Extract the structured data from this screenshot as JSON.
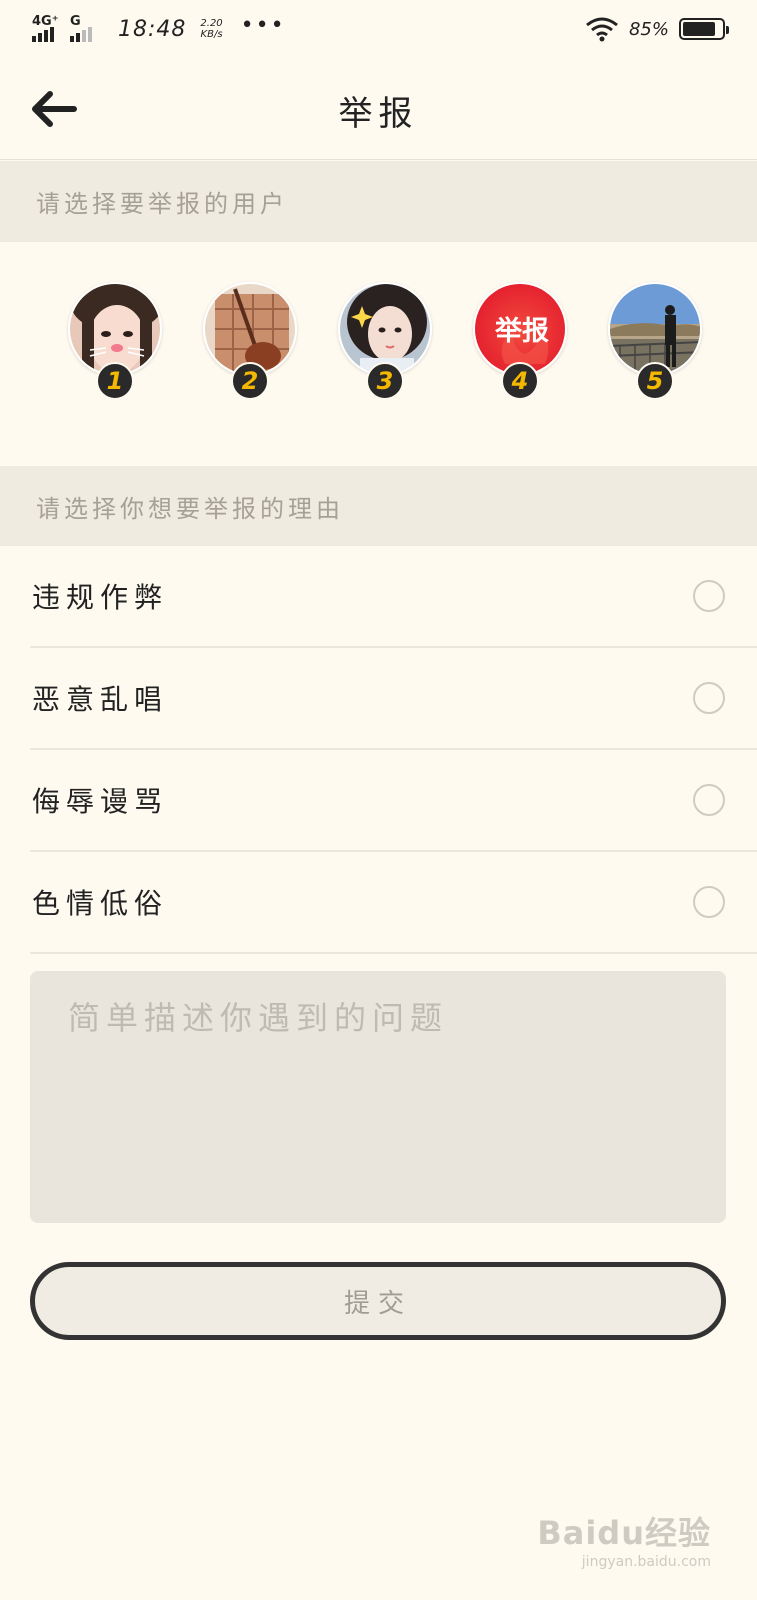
{
  "status_bar": {
    "signal1_label": "4G⁺",
    "signal2_label": "G",
    "time": "18:48",
    "speed_value": "2.20",
    "speed_unit": "KB/s",
    "more": "•••",
    "battery_percent": "85%",
    "battery_level": 0.85
  },
  "header": {
    "title": "举报",
    "back_icon": "arrow-left-icon"
  },
  "users_section": {
    "label": "请选择要举报的用户",
    "users": [
      {
        "number": "1",
        "avatar": "girl-cat-filter-avatar"
      },
      {
        "number": "2",
        "avatar": "girl-plaid-coat-avatar"
      },
      {
        "number": "3",
        "avatar": "girl-sparkle-avatar"
      },
      {
        "number": "4",
        "avatar": "report-logo-avatar",
        "avatar_text": "举报"
      },
      {
        "number": "5",
        "avatar": "man-railing-landscape-avatar"
      }
    ]
  },
  "reasons_section": {
    "label": "请选择你想要举报的理由",
    "options": [
      {
        "label": "违规作弊",
        "selected": false
      },
      {
        "label": "恶意乱唱",
        "selected": false
      },
      {
        "label": "侮辱谩骂",
        "selected": false
      },
      {
        "label": "色情低俗",
        "selected": false
      }
    ]
  },
  "description": {
    "placeholder": "简单描述你遇到的问题",
    "value": ""
  },
  "submit": {
    "label": "提交"
  },
  "watermark": {
    "main": "Baidu经验",
    "sub": "jingyan.baidu.com"
  }
}
